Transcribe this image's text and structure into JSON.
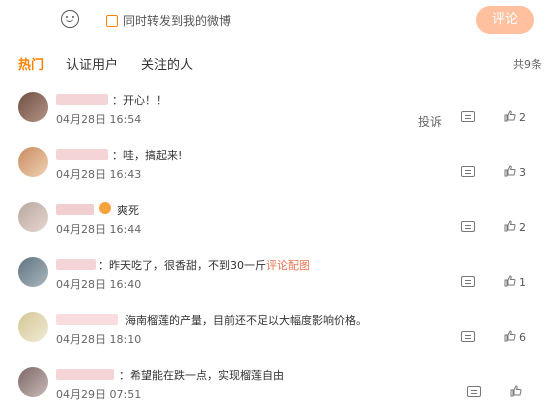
{
  "composer": {
    "repost_label": "同时转发到我的微博",
    "submit_label": "评论"
  },
  "tabs": [
    {
      "label": "热门",
      "active": true
    },
    {
      "label": "认证用户",
      "active": false
    },
    {
      "label": "关注的人",
      "active": false
    }
  ],
  "count_label": "共9条",
  "report_label": "投诉",
  "comments": [
    {
      "text": "：开心！！",
      "time": "04月28日 16:54",
      "likes": "2",
      "avatar_color": "#8a6a5a"
    },
    {
      "text": "：哇，搞起来!",
      "time": "04月28日 16:43",
      "likes": "3",
      "avatar_color": "#d9a67a"
    },
    {
      "text": "爽死",
      "time": "04月28日 16:44",
      "likes": "2",
      "avatar_color": "#c9b7b0"
    },
    {
      "text": "：昨天吃了，很香甜，不到30一斤",
      "link": "评论配图",
      "time": "04月28日 16:40",
      "likes": "1",
      "avatar_color": "#7f8e98"
    },
    {
      "text": "海南榴莲的产量，目前还不足以大幅度影响价格。",
      "time": "04月28日 18:10",
      "likes": "6",
      "avatar_color": "#e4d9b8"
    },
    {
      "text": "：希望能在跌一点，实现榴莲自由",
      "time": "04月29日 07:51",
      "likes": "",
      "avatar_color": "#a08c8a"
    }
  ]
}
